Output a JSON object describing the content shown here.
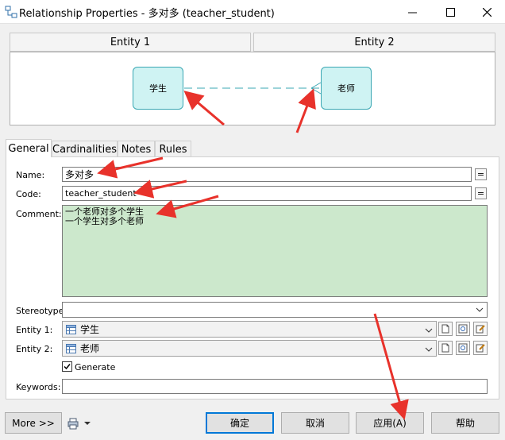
{
  "window": {
    "title": "Relationship Properties - 多对多 (teacher_student)"
  },
  "entities_header": {
    "entity1": "Entity 1",
    "entity2": "Entity 2"
  },
  "diagram": {
    "entity1_name": "学生",
    "entity2_name": "老师"
  },
  "tabs": [
    {
      "label": "General",
      "active": true
    },
    {
      "label": "Cardinalities"
    },
    {
      "label": "Notes"
    },
    {
      "label": "Rules"
    }
  ],
  "form": {
    "name_label": "Name:",
    "name_value": "多对多",
    "name_eq": "=",
    "code_label": "Code:",
    "code_value": "teacher_student",
    "code_eq": "=",
    "comment_label": "Comment:",
    "comment_lines": [
      "一个老师对多个学生",
      "一个学生对多个老师"
    ],
    "stereotype_label": "Stereotype:",
    "stereotype_value": "",
    "entity1_label": "Entity 1:",
    "entity1_value": "学生",
    "entity2_label": "Entity 2:",
    "entity2_value": "老师",
    "generate_label": "Generate",
    "generate_checked": true,
    "keywords_label": "Keywords:",
    "keywords_value": ""
  },
  "buttons": {
    "more": "More >>",
    "ok": "确定",
    "cancel": "取消",
    "apply": "应用(A)",
    "help": "帮助"
  },
  "colors": {
    "entity_fill": "#cff3f3",
    "entity_border": "#3aa7b3",
    "comment_bg": "#cce8cc",
    "annotation_arrow": "#e8322b",
    "default_button_border": "#0078d7"
  },
  "icons": [
    "relationship-icon",
    "minimize-icon",
    "maximize-icon",
    "close-icon",
    "table-icon",
    "new-object-icon",
    "properties-icon",
    "edit-icon",
    "chevron-down-icon",
    "print-menu-icon"
  ]
}
